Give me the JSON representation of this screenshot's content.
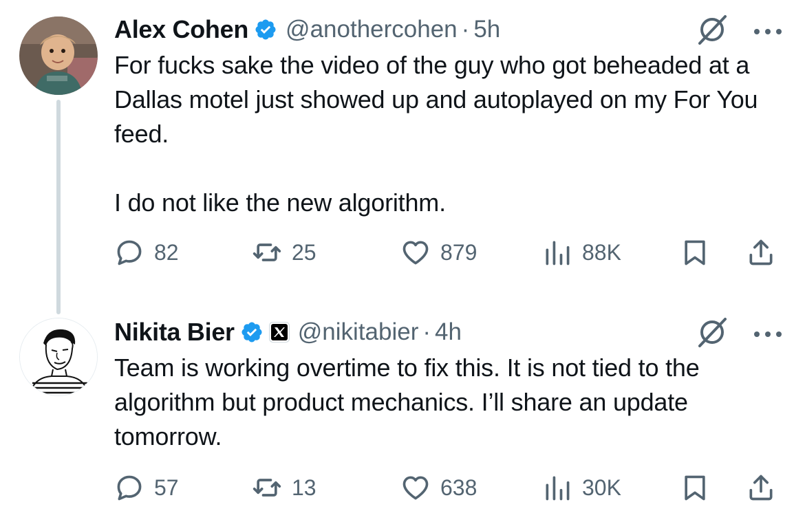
{
  "tweets": [
    {
      "author": {
        "name": "Alex Cohen",
        "handle": "@anothercohen",
        "verified": true
      },
      "separator": "·",
      "time": "5h",
      "text": "For fucks sake the video of the guy who got beheaded at a Dallas motel just showed up and autoplayed on my For You feed.\n\nI do not like the new algorithm.",
      "stats": {
        "replies": "82",
        "reposts": "25",
        "likes": "879",
        "views": "88K"
      }
    },
    {
      "author": {
        "name": "Nikita Bier",
        "handle": "@nikitabier",
        "verified": true,
        "affiliation_icon": "x-logo-icon"
      },
      "separator": "·",
      "time": "4h",
      "text": "Team is working overtime to fix this. It is not tied to the algorithm but product mechanics. I’ll share an update tomorrow.",
      "stats": {
        "replies": "57",
        "reposts": "13",
        "likes": "638",
        "views": "30K"
      }
    }
  ],
  "icons": {
    "verified": "verified-badge-icon",
    "grok": "grok-icon",
    "more": "more-dots-icon",
    "reply": "reply-icon",
    "repost": "repost-icon",
    "like": "heart-icon",
    "views": "views-chart-icon",
    "bookmark": "bookmark-icon",
    "share": "share-icon"
  },
  "colors": {
    "verified_blue": "#1d9bf0",
    "secondary_text": "#536471",
    "primary_text": "#0f1419",
    "thread_line": "#cfd9de"
  }
}
